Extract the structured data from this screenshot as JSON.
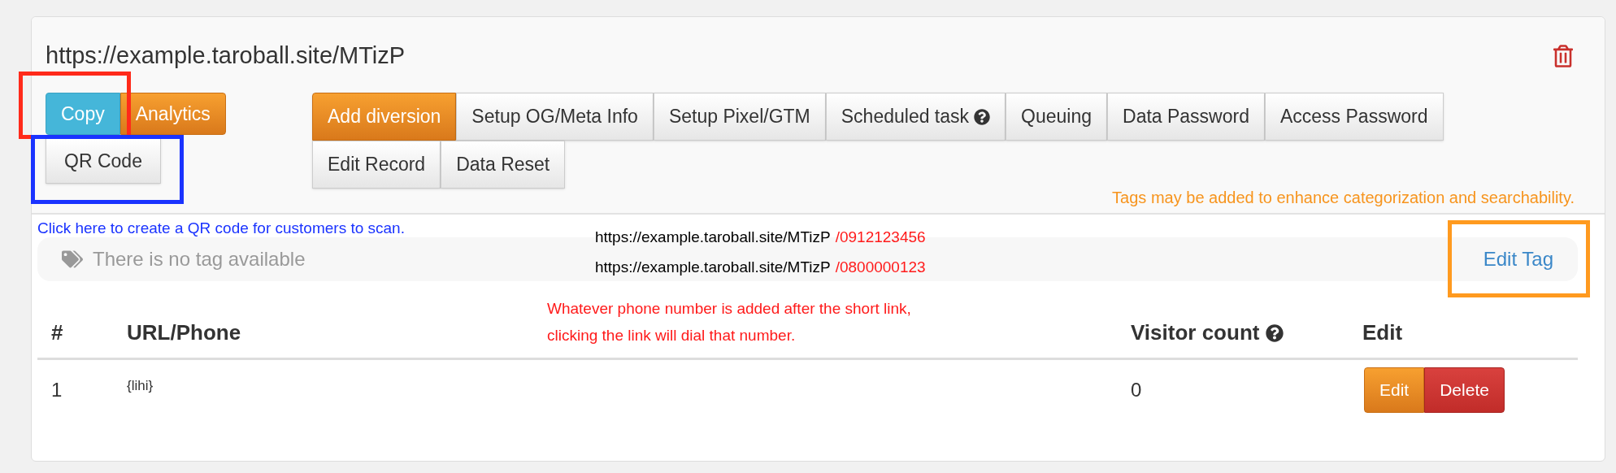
{
  "short_url": "https://example.taroball.site/MTizP",
  "actions": [
    {
      "label": "Copy",
      "kind": "info"
    },
    {
      "label": "Analytics",
      "kind": "warning"
    },
    {
      "label": "QR Code",
      "kind": "default"
    }
  ],
  "tool_rows": [
    [
      {
        "label": "Add diversion",
        "kind": "warning",
        "help": false
      },
      {
        "label": "Setup OG/Meta Info",
        "kind": "default",
        "help": false
      },
      {
        "label": "Setup Pixel/GTM",
        "kind": "default",
        "help": false
      },
      {
        "label": "Scheduled task",
        "kind": "default",
        "help": true
      },
      {
        "label": "Queuing",
        "kind": "default",
        "help": false
      },
      {
        "label": "Data Password",
        "kind": "default",
        "help": false
      },
      {
        "label": "Access Password",
        "kind": "default",
        "help": false
      }
    ],
    [
      {
        "label": "Edit Record",
        "kind": "default",
        "help": false
      },
      {
        "label": "Data Reset",
        "kind": "default",
        "help": false
      }
    ]
  ],
  "tags_hint": "Tags may be added to enhance categorization and searchability.",
  "qr_note": "Click here to create a QR code for customers to scan.",
  "tags": {
    "empty_text": "There is no tag available",
    "edit_label": "Edit Tag"
  },
  "phone_examples": [
    {
      "base": "https://example.taroball.site/MTizP",
      "suffix": "/0912123456"
    },
    {
      "base": "https://example.taroball.site/MTizP",
      "suffix": "/0800000123"
    }
  ],
  "phone_note": [
    "Whatever phone number is added after the short link,",
    "clicking the link will dial that number."
  ],
  "highlights": [
    {
      "color": "#ff2a1a"
    },
    {
      "color": "#1a33ff"
    },
    {
      "color": "#ff9a1f"
    }
  ],
  "table": {
    "columns": [
      {
        "label": "#",
        "help": false
      },
      {
        "label": "URL/Phone",
        "help": false
      },
      {
        "label": "Visitor count",
        "help": true
      },
      {
        "label": "Edit",
        "help": false
      }
    ],
    "rows": [
      {
        "index": "1",
        "url": "{lihi}",
        "visitors": "0",
        "actions": [
          {
            "label": "Edit",
            "kind": "warning"
          },
          {
            "label": "Delete",
            "kind": "danger"
          }
        ]
      }
    ]
  }
}
